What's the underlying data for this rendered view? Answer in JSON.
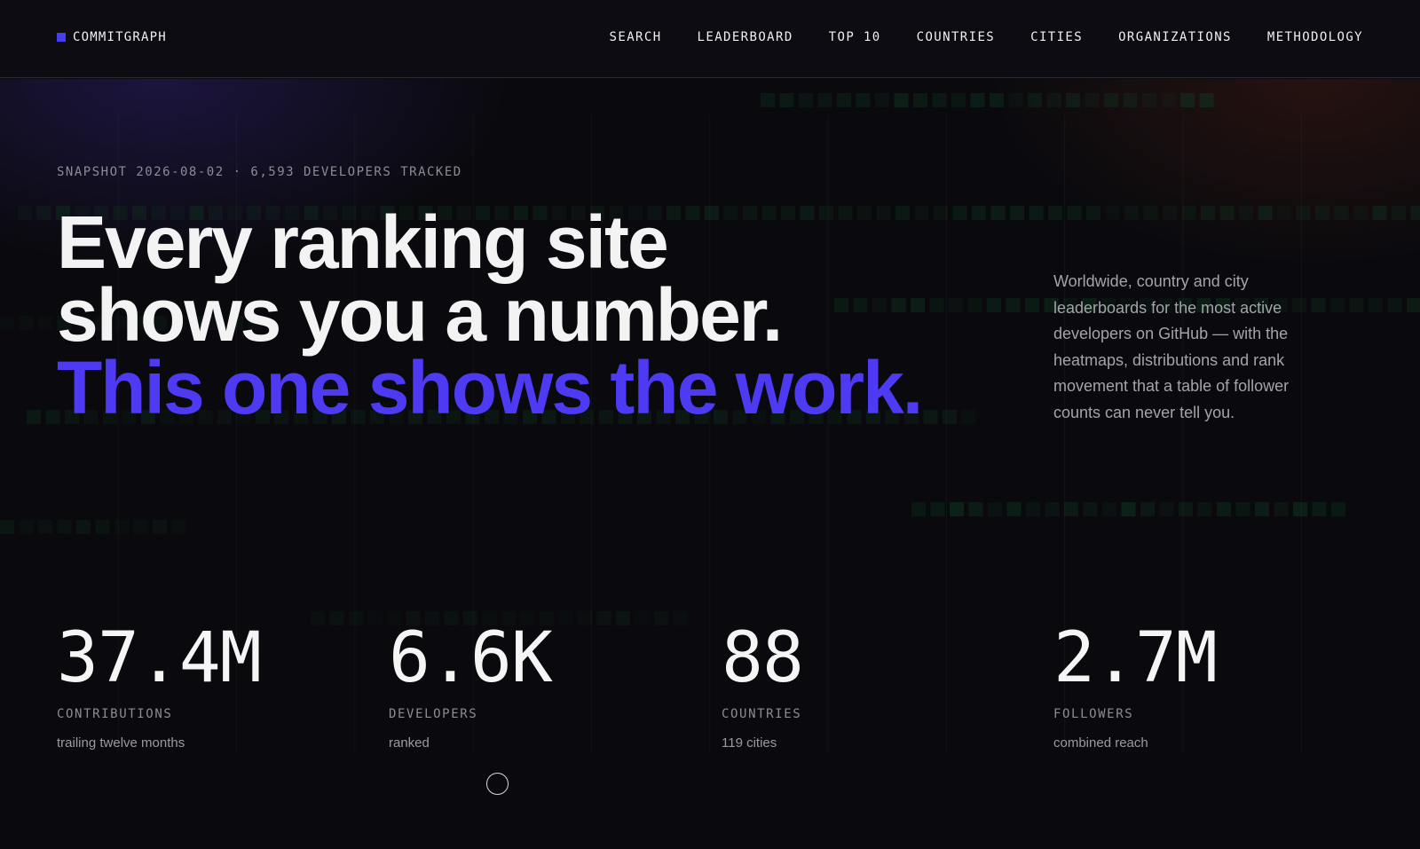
{
  "nav": {
    "brand": "COMMITGRAPH",
    "links": [
      {
        "label": "SEARCH"
      },
      {
        "label": "LEADERBOARD"
      },
      {
        "label": "TOP 10"
      },
      {
        "label": "COUNTRIES"
      },
      {
        "label": "CITIES"
      },
      {
        "label": "ORGANIZATIONS"
      },
      {
        "label": "METHODOLOGY"
      }
    ]
  },
  "hero": {
    "snapshot": "SNAPSHOT 2026-08-02 · 6,593 DEVELOPERS TRACKED",
    "headline_line1": "Every ranking site",
    "headline_line2": "shows you a number.",
    "headline_accent": "This one shows the work.",
    "blurb": "Worldwide, country and city leaderboards for the most active developers on GitHub — with the heatmaps, distributions and rank movement that a table of follower counts can never tell you."
  },
  "stats": [
    {
      "value": "37.4M",
      "label": "CONTRIBUTIONS",
      "sub": "trailing twelve months"
    },
    {
      "value": "6.6K",
      "label": "DEVELOPERS",
      "sub": "ranked"
    },
    {
      "value": "88",
      "label": "COUNTRIES",
      "sub": "119 cities"
    },
    {
      "value": "2.7M",
      "label": "FOLLOWERS",
      "sub": "combined reach"
    }
  ],
  "colors": {
    "accent": "#4d3af2",
    "background": "#0a0a0e",
    "heatmap_cell": "#0f3a22"
  }
}
